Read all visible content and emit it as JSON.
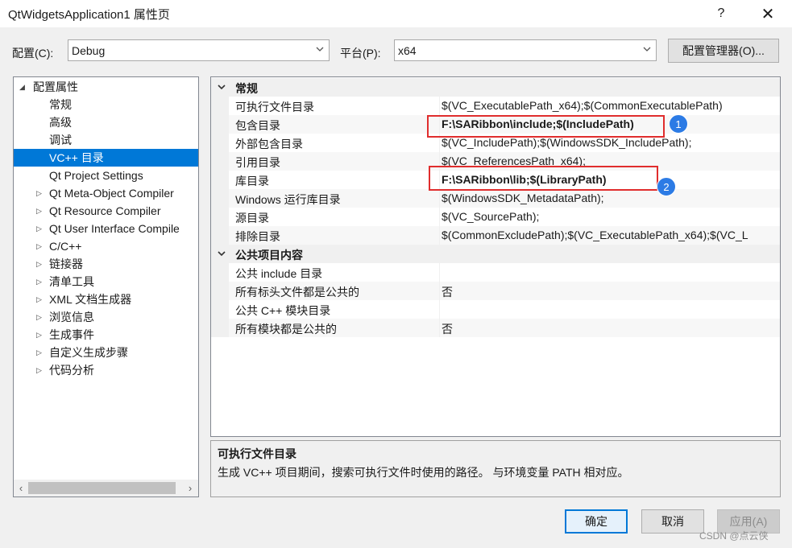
{
  "window": {
    "title": "QtWidgetsApplication1 属性页",
    "help": "?",
    "close": "✕"
  },
  "config": {
    "config_label": "配置(C):",
    "config_value": "Debug",
    "platform_label": "平台(P):",
    "platform_value": "x64",
    "manager_button": "配置管理器(O)..."
  },
  "tree": {
    "root": "配置属性",
    "items": [
      {
        "label": "常规",
        "expandable": false
      },
      {
        "label": "高级",
        "expandable": false
      },
      {
        "label": "调试",
        "expandable": false
      },
      {
        "label": "VC++ 目录",
        "expandable": false,
        "selected": true
      },
      {
        "label": "Qt Project Settings",
        "expandable": false
      },
      {
        "label": "Qt Meta-Object Compiler",
        "expandable": true
      },
      {
        "label": "Qt Resource Compiler",
        "expandable": true
      },
      {
        "label": "Qt User Interface Compile",
        "expandable": true
      },
      {
        "label": "C/C++",
        "expandable": true
      },
      {
        "label": "链接器",
        "expandable": true
      },
      {
        "label": "清单工具",
        "expandable": true
      },
      {
        "label": "XML 文档生成器",
        "expandable": true
      },
      {
        "label": "浏览信息",
        "expandable": true
      },
      {
        "label": "生成事件",
        "expandable": true
      },
      {
        "label": "自定义生成步骤",
        "expandable": true
      },
      {
        "label": "代码分析",
        "expandable": true
      }
    ]
  },
  "grid": {
    "sections": [
      {
        "title": "常规",
        "rows": [
          {
            "name": "可执行文件目录",
            "value": "$(VC_ExecutablePath_x64);$(CommonExecutablePath)"
          },
          {
            "name": "包含目录",
            "value": "F:\\SARibbon\\include;$(IncludePath)",
            "bold": true
          },
          {
            "name": "外部包含目录",
            "value": "$(VC_IncludePath);$(WindowsSDK_IncludePath);"
          },
          {
            "name": "引用目录",
            "value": "$(VC_ReferencesPath_x64);"
          },
          {
            "name": "库目录",
            "value": "F:\\SARibbon\\lib;$(LibraryPath)",
            "bold": true
          },
          {
            "name": "Windows 运行库目录",
            "value": "$(WindowsSDK_MetadataPath);"
          },
          {
            "name": "源目录",
            "value": "$(VC_SourcePath);"
          },
          {
            "name": "排除目录",
            "value": "$(CommonExcludePath);$(VC_ExecutablePath_x64);$(VC_L"
          }
        ]
      },
      {
        "title": "公共项目内容",
        "rows": [
          {
            "name": "公共 include 目录",
            "value": ""
          },
          {
            "name": "所有标头文件都是公共的",
            "value": "否"
          },
          {
            "name": "公共 C++ 模块目录",
            "value": ""
          },
          {
            "name": "所有模块都是公共的",
            "value": "否"
          }
        ]
      }
    ]
  },
  "annotations": {
    "badge1": "1",
    "badge2": "2"
  },
  "description": {
    "title": "可执行文件目录",
    "text": "生成 VC++ 项目期间，搜索可执行文件时使用的路径。 与环境变量 PATH 相对应。"
  },
  "buttons": {
    "ok": "确定",
    "cancel": "取消",
    "apply": "应用(A)"
  },
  "watermark": "CSDN @点云侠",
  "colors": {
    "selection": "#0078d7",
    "highlight": "#e02d2d",
    "badge": "#2c7be5"
  }
}
